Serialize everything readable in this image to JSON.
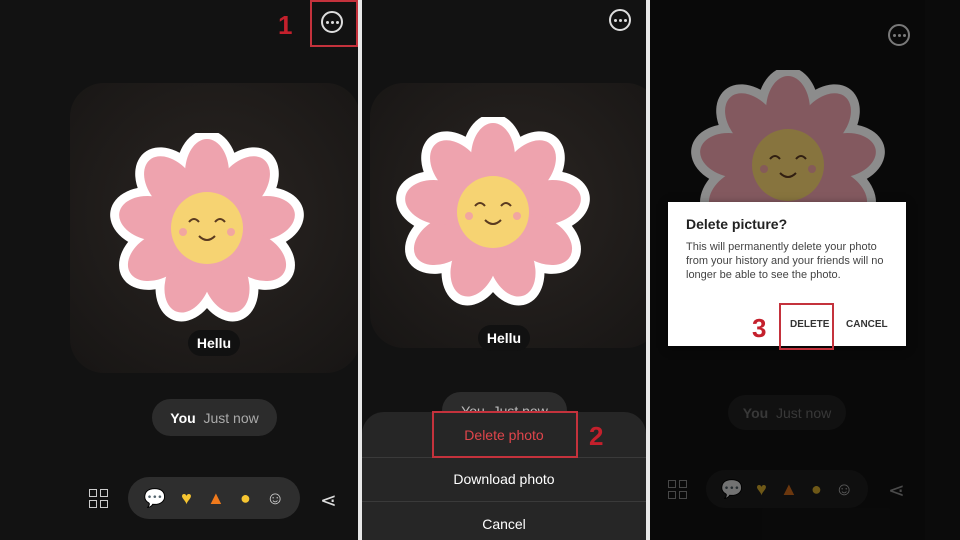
{
  "panel1": {
    "step": "1",
    "caption": "Hellu",
    "sender": "You",
    "time": "Just now"
  },
  "panel2": {
    "step": "2",
    "caption": "Hellu",
    "sender": "You",
    "time": "Just now",
    "sheet": {
      "delete": "Delete photo",
      "download": "Download photo",
      "cancel": "Cancel"
    }
  },
  "panel3": {
    "step": "3",
    "sender": "You",
    "time": "Just now",
    "dialog": {
      "title": "Delete picture?",
      "body": "This will permanently delete your photo from your history and your friends will no longer be able to see the photo.",
      "delete": "DELETE",
      "cancel": "CANCEL"
    }
  },
  "reactions": [
    "chat-bubble-icon",
    "yellow-heart-icon",
    "fire-icon",
    "laughing-face-icon",
    "add-emoji-icon"
  ],
  "colors": {
    "accent_red": "#c4202c",
    "delete_text": "#e0454b",
    "petal": "#eea3ae",
    "center": "#f6d372"
  }
}
